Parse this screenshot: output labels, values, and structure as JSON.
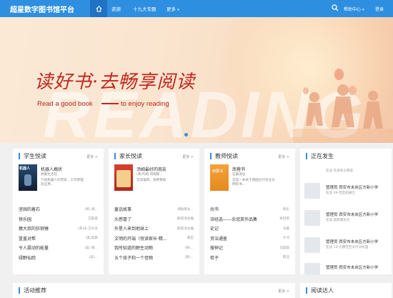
{
  "header": {
    "brand": "超星数字图书馆平台",
    "nav": [
      "资源",
      "十九大专题",
      "更多"
    ],
    "help": "帮助中心",
    "login": "登录"
  },
  "banner": {
    "slogan_cn": "读好书·去畅享阅读",
    "slogan_en1": "Read a good book",
    "slogan_en2": "to enjoy reading",
    "bg_word": "READING"
  },
  "sections": {
    "student": {
      "title": "学生悦读",
      "more": "更多 >",
      "cover_text": "机器人",
      "feat_title": "机器人瘾状",
      "feat_lines": [
        "厨餐生活馆",
        "介绍机器人的历史、工作原理",
        "及应用..."
      ],
      "items": [
        {
          "t": "坚固的着石",
          "a": "(英) 德..."
        },
        {
          "t": "快乐园",
          "a": "艾斯基"
        },
        {
          "t": "猿大叔的狂铜锤",
          "a": "(英)天·艾尔夫"
        },
        {
          "t": "篮盖对帮",
          "a": "(美)皮斯"
        },
        {
          "t": "令人震动的能量",
          "a": "(美) 德..."
        },
        {
          "t": "绿野仙踪",
          "a": "(美)..."
        }
      ]
    },
    "parent": {
      "title": "家长悦读",
      "more": "更多 >",
      "feat_title": "汤姆最好的朋友",
      "feat_lines": [
        "(英)玛莉·阿姆斯...",
        "流浪猫和、领养救赎"
      ],
      "items": [
        {
          "t": "童话故事",
          "a": "郑振铎主..."
        },
        {
          "t": "头感冒了",
          "a": "斯提洛主编"
        },
        {
          "t": "外星人来到地球上",
          "a": "斯提洛主编"
        },
        {
          "t": "文明的开端（悦读家长·精...",
          "a": "黄忠"
        },
        {
          "t": "我所知道的野生动物",
          "a": "(英)..."
        },
        {
          "t": "五个孩子和一个怪物",
          "a": "(英)..."
        }
      ]
    },
    "teacher": {
      "title": "教师悦读",
      "more": "更多 >",
      "cover_text": "南蓉书",
      "feat_title": "南蓉书",
      "feat_lines": [
        "石磊译注",
        "这是一本关于我国古代农业文",
        "明的书..."
      ],
      "items": [
        {
          "t": "尚书",
          "a": "周乐"
        },
        {
          "t": "诗经选——余冠英作品集",
          "a": "余冠英"
        },
        {
          "t": "史记",
          "a": "马嘉"
        },
        {
          "t": "资治通鉴",
          "a": "于鸿"
        },
        {
          "t": "搜神记",
          "a": "马韵森"
        },
        {
          "t": "荀子",
          "a": "荀况"
        }
      ]
    },
    "happening": {
      "title": "正在发生",
      "top_text": "在读 毛泽东与韩非",
      "feed": [
        {
          "name": "管理员 西安市未央区方新小学",
          "text": "在读 09-范型机械兰"
        },
        {
          "name": "管理员 西安市未央区方新小学",
          "text": "在读 超新量化元"
        },
        {
          "name": "管理员 西安市未央区方新小学",
          "text": "在读 10-力撑空空天叶对村里"
        },
        {
          "name": "管理员 西安市未央区方新小学",
          "text": ""
        }
      ]
    },
    "activity": {
      "title": "活动推荐",
      "more": "更多 >"
    },
    "readers": {
      "title": "阅读达人"
    }
  },
  "colors": {
    "accent": "#2e8fe0",
    "slogan": "#c0271f"
  }
}
